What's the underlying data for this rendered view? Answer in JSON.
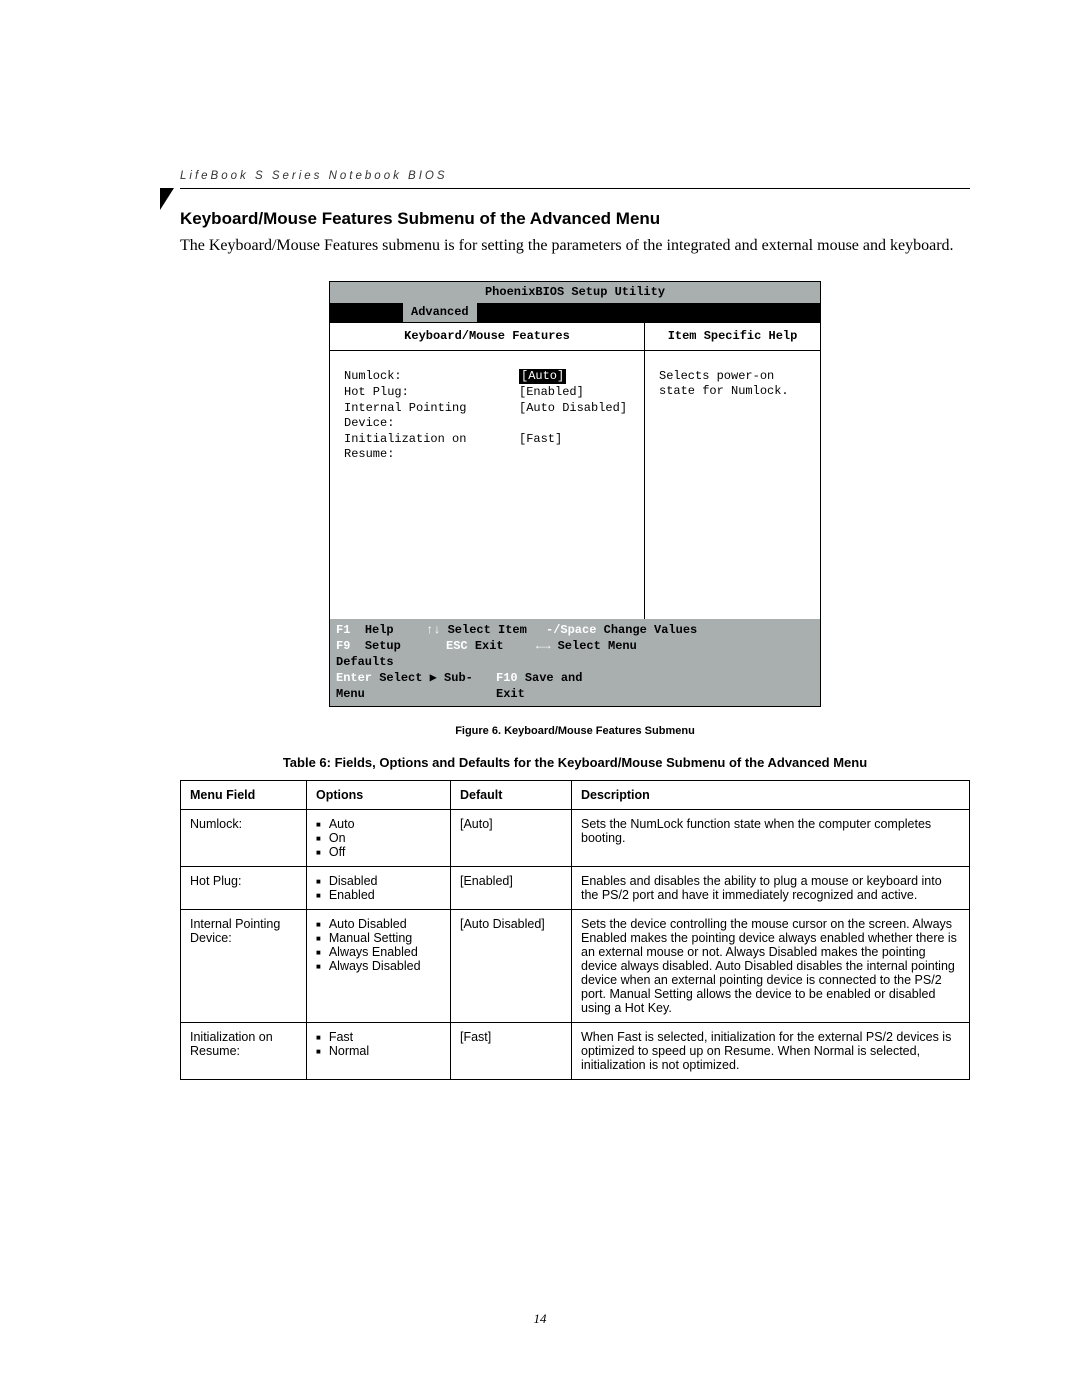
{
  "running_header": "LifeBook S Series Notebook BIOS",
  "section_heading": "Keyboard/Mouse Features Submenu of the Advanced Menu",
  "intro_paragraph": "The Keyboard/Mouse Features submenu is for setting the parameters of the integrated and external mouse and keyboard.",
  "bios": {
    "title": "PhoenixBIOS Setup Utility",
    "active_menu": "Advanced",
    "left_header": "Keyboard/Mouse Features",
    "right_header": "Item Specific Help",
    "rows": [
      {
        "label": "Numlock:",
        "value": "[Auto]",
        "selected": true
      },
      {
        "label": "Hot Plug:",
        "value": "[Enabled]",
        "selected": false
      },
      {
        "label": "Internal Pointing Device:",
        "value": "[Auto Disabled]",
        "selected": false
      },
      {
        "label": "Initialization on Resume:",
        "value": "[Fast]",
        "selected": false
      }
    ],
    "help_text": "Selects power-on state for Numlock.",
    "footer": {
      "f1": "F1",
      "help": "Help",
      "updown": "↑↓",
      "select_item": "Select Item",
      "space_key": "-/Space",
      "change_values": "Change Values",
      "f9": "F9",
      "setup_defaults": "Setup Defaults",
      "esc": "ESC",
      "exit": "Exit",
      "leftright": "←→",
      "select_menu": "Select Menu",
      "enter": "Enter",
      "select_sub": "Select ▶ Sub-Menu",
      "f10": "F10",
      "save_exit": "Save and Exit"
    }
  },
  "figure_caption": "Figure 6.  Keyboard/Mouse Features Submenu",
  "table_caption": "Table 6: Fields, Options and Defaults for the Keyboard/Mouse Submenu of the Advanced Menu",
  "table": {
    "headers": {
      "menu_field": "Menu Field",
      "options": "Options",
      "default": "Default",
      "description": "Description"
    },
    "rows": [
      {
        "menu_field": "Numlock:",
        "options": [
          "Auto",
          "On",
          "Off"
        ],
        "default": "[Auto]",
        "description": "Sets the NumLock function state when the computer completes booting."
      },
      {
        "menu_field": "Hot Plug:",
        "options": [
          "Disabled",
          "Enabled"
        ],
        "default": "[Enabled]",
        "description": "Enables and disables the ability to plug a mouse or keyboard into the PS/2 port and have it immediately recognized and active."
      },
      {
        "menu_field": "Internal Pointing Device:",
        "options": [
          "Auto Disabled",
          "Manual Setting",
          "Always Enabled",
          "Always Disabled"
        ],
        "default": "[Auto Disabled]",
        "description": "Sets the device controlling the mouse cursor on the screen. Always Enabled makes the pointing device always enabled whether there is an external mouse or not. Always Disabled makes the pointing device always disabled. Auto Disabled disables the internal pointing device when an external pointing device is connected to the PS/2 port. Manual Setting allows the device to be enabled or disabled using a Hot Key."
      },
      {
        "menu_field": "Initialization on Resume:",
        "options": [
          "Fast",
          "Normal"
        ],
        "default": "[Fast]",
        "description": "When Fast is selected, initialization for the external PS/2 devices is optimized to speed up on Resume. When Normal is selected, initialization is not optimized."
      }
    ]
  },
  "page_number": "14"
}
